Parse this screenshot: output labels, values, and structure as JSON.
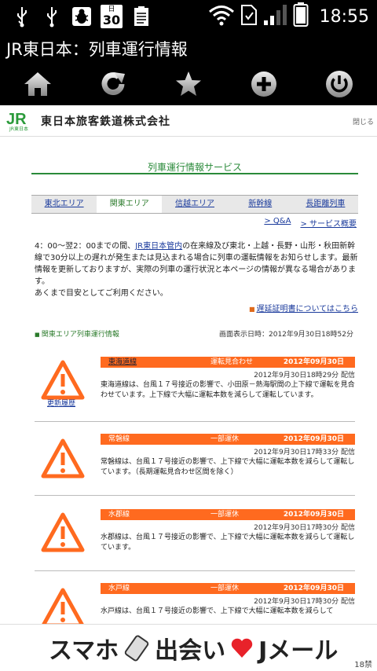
{
  "status_bar": {
    "calendar_month": "日",
    "calendar_day": "30",
    "time": "18:55"
  },
  "app": {
    "title": "JR東日本：列車運行情報"
  },
  "toolbar": {
    "buttons": [
      {
        "icon": "home-icon"
      },
      {
        "icon": "refresh-icon"
      },
      {
        "icon": "star-icon"
      },
      {
        "icon": "add-icon"
      },
      {
        "icon": "power-icon"
      }
    ]
  },
  "header": {
    "logo_text": "JR東日本",
    "company": "東日本旅客鉄道株式会社",
    "close": "閉じる"
  },
  "service": {
    "title": "列車運行情報サービス"
  },
  "tabs": [
    {
      "label": "東北エリア",
      "active": false
    },
    {
      "label": "関東エリア",
      "active": true
    },
    {
      "label": "信越エリア",
      "active": false
    },
    {
      "label": "新幹線",
      "active": false
    },
    {
      "label": "長距離列車",
      "active": false
    }
  ],
  "sublinks": {
    "qa": "> Q&A",
    "overview": "> サービス概要"
  },
  "intro": {
    "part1": "4：00～翌2：00までの間、",
    "link": "JR東日本管内",
    "part2": "の在来線及び東北・上越・長野・山形・秋田新幹線で30分以上の遅れが発生または見込まれる場合に列車の運転情報をお知らせします。最新情報を更新しておりますが、実際の列車の運行状況と本ページの情報が異なる場合があります。",
    "part3": "あくまで目安としてご利用ください。"
  },
  "cert_link": "遅延証明書についてはこちら",
  "area": {
    "heading": "関東エリア列車運行情報",
    "display_time": "画面表示日時：2012年9月30日18時52分"
  },
  "incidents": [
    {
      "line": "東海道線",
      "status": "運転見合わせ",
      "date": "2012年09月30日",
      "issued": "2012年9月30日18時29分 配信",
      "text": "東海道線は、台風１７号接近の影響で、小田原－熱海駅間の上下線で運転を見合わせています。上下線で大幅に運転本数を減らして運転しています。",
      "history": "更新履歴"
    },
    {
      "line": "常磐線",
      "status": "一部運休",
      "date": "2012年09月30日",
      "issued": "2012年9月30日17時33分 配信",
      "text": "常磐線は、台風１７号接近の影響で、上下線で大幅に運転本数を減らして運転しています。（長期運転見合わせ区間を除く）"
    },
    {
      "line": "水郡線",
      "status": "一部運休",
      "date": "2012年09月30日",
      "issued": "2012年9月30日17時30分 配信",
      "text": "水郡線は、台風１７号接近の影響で、上下線で大幅に運転本数を減らして運転しています。"
    },
    {
      "line": "水戸線",
      "status": "一部運休",
      "date": "2012年09月30日",
      "issued": "2012年9月30日17時30分 配信",
      "text": "水戸線は、台風１７号接近の影響で、上下線で大幅に運転本数を減らして"
    }
  ],
  "ad": {
    "part1": "スマホ",
    "part2": "出会い",
    "part3": "Jメール",
    "badge": "18禁"
  },
  "colors": {
    "accent_orange": "#ff6a1f",
    "jr_green": "#2a8a3a",
    "link_blue": "#1a3a9c"
  }
}
